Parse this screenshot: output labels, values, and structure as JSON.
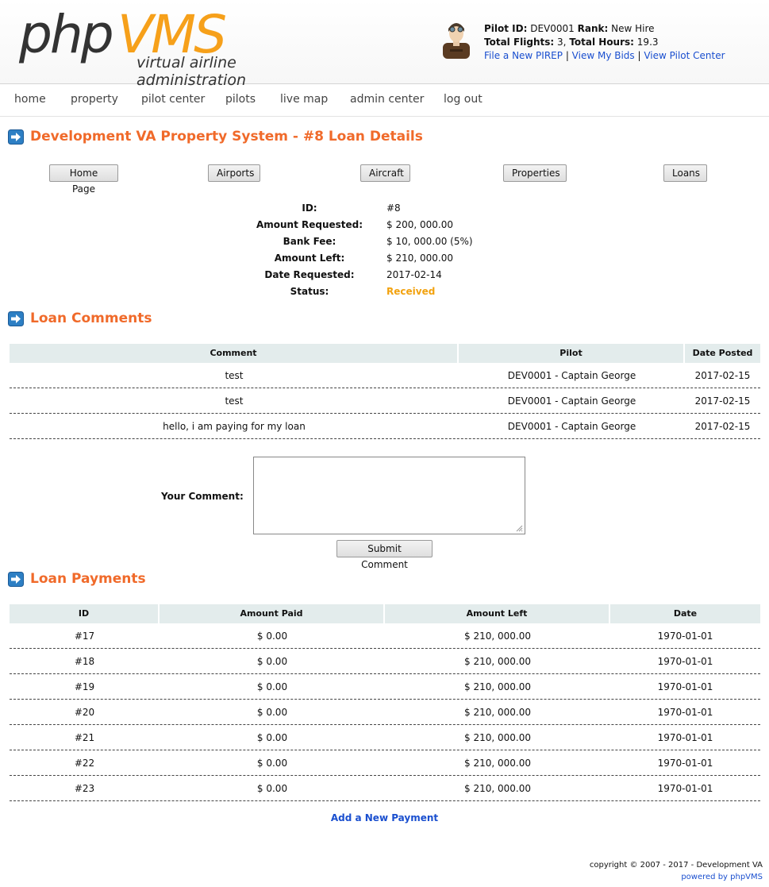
{
  "header": {
    "logo_php": "php",
    "logo_vms": "VMS",
    "logo_tagline": "virtual airline administration",
    "pilot_id_label": "Pilot ID:",
    "pilot_id": "DEV0001",
    "rank_label": "Rank:",
    "rank": "New Hire",
    "flights_label": "Total Flights:",
    "flights": "3",
    "hours_label": "Total Hours:",
    "hours": "19.3",
    "links": [
      "File a New PIREP",
      "View My Bids",
      "View Pilot Center"
    ]
  },
  "nav": [
    "home",
    "property",
    "pilot center",
    "pilots",
    "live map",
    "admin center",
    "log out"
  ],
  "page_title": "Development VA Property System - #8 Loan Details",
  "buttons": [
    "Home Page",
    "Airports",
    "Aircraft",
    "Properties",
    "Loans"
  ],
  "details": [
    {
      "label": "ID:",
      "value": "#8"
    },
    {
      "label": "Amount Requested:",
      "value": "$ 200, 000.00"
    },
    {
      "label": "Bank Fee:",
      "value": "$ 10, 000.00 (5%)"
    },
    {
      "label": "Amount Left:",
      "value": "$ 210, 000.00"
    },
    {
      "label": "Date Requested:",
      "value": "2017-02-14"
    },
    {
      "label": "Status:",
      "value": "Received"
    }
  ],
  "comments_title": "Loan Comments",
  "comments_headers": [
    "Comment",
    "Pilot",
    "Date Posted"
  ],
  "comments": [
    {
      "comment": "test",
      "pilot": "DEV0001 - Captain George",
      "date": "2017-02-15"
    },
    {
      "comment": "test",
      "pilot": "DEV0001 - Captain George",
      "date": "2017-02-15"
    },
    {
      "comment": "hello, i am paying for my loan",
      "pilot": "DEV0001 - Captain George",
      "date": "2017-02-15"
    }
  ],
  "comment_form": {
    "label": "Your Comment:",
    "value": "",
    "submit": "Submit Comment"
  },
  "payments_title": "Loan Payments",
  "payments_headers": [
    "ID",
    "Amount Paid",
    "Amount Left",
    "Date"
  ],
  "payments": [
    {
      "id": "#17",
      "paid": "$ 0.00",
      "left": "$ 210, 000.00",
      "date": "1970-01-01"
    },
    {
      "id": "#18",
      "paid": "$ 0.00",
      "left": "$ 210, 000.00",
      "date": "1970-01-01"
    },
    {
      "id": "#19",
      "paid": "$ 0.00",
      "left": "$ 210, 000.00",
      "date": "1970-01-01"
    },
    {
      "id": "#20",
      "paid": "$ 0.00",
      "left": "$ 210, 000.00",
      "date": "1970-01-01"
    },
    {
      "id": "#21",
      "paid": "$ 0.00",
      "left": "$ 210, 000.00",
      "date": "1970-01-01"
    },
    {
      "id": "#22",
      "paid": "$ 0.00",
      "left": "$ 210, 000.00",
      "date": "1970-01-01"
    },
    {
      "id": "#23",
      "paid": "$ 0.00",
      "left": "$ 210, 000.00",
      "date": "1970-01-01"
    }
  ],
  "add_payment": "Add a New Payment",
  "footer": {
    "copyright": "copyright © 2007 - 2017 - Development VA",
    "powered": "powered by phpVMS"
  },
  "colors": {
    "accent": "#f06a2a",
    "logo_orange": "#f6a01a",
    "link": "#1a4fcf",
    "status": "#f2a20f",
    "table_header": "#e3ecec"
  },
  "icons": [
    "pilot-avatar-icon",
    "arrow-right-icon",
    "resize-grip-icon"
  ]
}
